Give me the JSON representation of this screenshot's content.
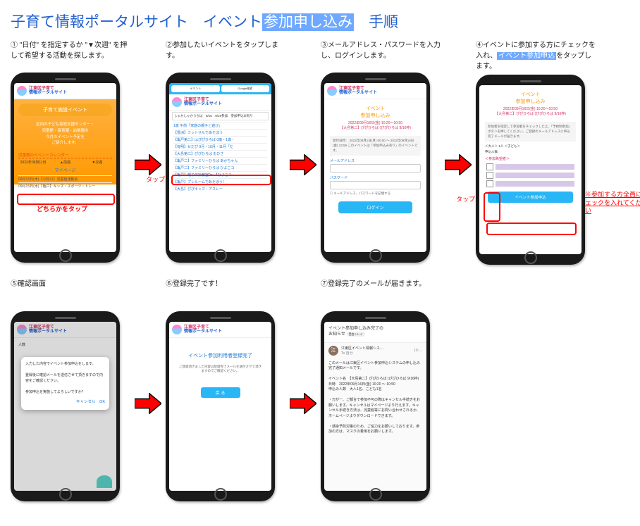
{
  "title_a": "子育て情報ポータルサイト　イベント",
  "title_hl": "参加申し込み",
  "title_b": "　手順",
  "steps": {
    "s1": "① \"日付\" を指定するか \"▼次週\" を押して希望する活動を探します。",
    "s2": "②参加したいイベントをタップします。",
    "s3": "③メールアドレス・パスワードを入力し、ログインします。",
    "s4a": "④イベントに参加する方にチェックを入れ、",
    "s4hl": "イベント参加申込",
    "s4b": "をタップします。",
    "s5": "⑤確認画面",
    "s6": "⑥登録完了です！",
    "s7": "⑦登録完了のメールが届きます。"
  },
  "portal": {
    "l1": "江東区子育て",
    "l2": "情報ポータルサイト"
  },
  "s1": {
    "ribbon": "子育て施設イベント",
    "intro1": "区内の子ども家庭支援センター・",
    "intro2": "児童館・保育園・幼稚園の",
    "intro3": "今月のイベント予定を",
    "intro4": "ご紹介します。",
    "cal": "児童館のイベントカレンダー",
    "date": "2022年09月11日",
    "prev": "▲前週",
    "next": "▼次週",
    "tap": "どちらかをタップ",
    "mypage": "マイページ",
    "e1": "09月15日(木)【小松川】児童館運動会",
    "e2": "09月15日(木)【亀戸】キッズ・スポーツ・トレー"
  },
  "s2": {
    "tab1": "イベント",
    "tab2": "Google検索",
    "head": "しゃかしゃかうちは　9/16　9/19参加　参加申込み有り",
    "i1": "1歳 午前「家庭の親子と遊び」",
    "i2": "【豊洲】フットサルであそぼう",
    "i3": "【亀戸第二】はぴぴひろば 0歳・1歳・",
    "i4": "【有明】せだぴ 9月・10月・11月「だ",
    "i5": "【大島第二】ぴぴひろば おひさ",
    "i6": "【亀戸二】ファミリーひろば あかちゃん",
    "i7": "【亀戸二】ファミリーひろば ひよこコ",
    "i8": "【亀戸】親子体操教室9～【ひよこコ",
    "i9": "【亀戸】プレルームであそぼう！",
    "i10": "【大島】ぴぴキッズ・アスレー",
    "tap": "タップ"
  },
  "s3": {
    "title": "イベント",
    "sub": "参加申し込み",
    "evt1": "2022年09月16日(金) 10:20～10:50",
    "evt2": "【大島第二】ぴぴひろば (ぴぴひろば 9/16枠)",
    "box": "受付日時： 2022年08月1日(月) 00:00 ～ 2022年09月16日(金) 23:59\nこのイベントは「参加申込み有り」のイベントです。",
    "l_mail": "メールアドレス",
    "l_pass": "パスワード",
    "remember": "メールアドレス、パスワードを記憶する",
    "login": "ログイン"
  },
  "s4": {
    "title": "イベント",
    "sub": "参加申し込み",
    "evt1": "2022年09月16日(金) 10:20～10:50",
    "evt2": "【大島第二】ぴぴひろば (ぴぴひろば 9/16枠)",
    "inst": "参加者を指定して参加者をチェックした上、「予約制参加」ボタンを押してください。ご登録のメールアドレスに申込完了メールが届きます。",
    "people": "＜大人＞ 1人 ＜子ども＞",
    "num": "申込人数:",
    "chkhead": "＜参加希望者＞",
    "apply": "イベント参加申込",
    "tap": "タップ",
    "note": "※参加する方全員にチェックを入れてください"
  },
  "s5": {
    "people": "人数",
    "d1": "入力した内容でイベント参加申込をします。",
    "d2": "登録後に確認メールを送信させて頂きますので内容をご確認ください。",
    "d3": "参加申込を実施してよろしいですか？",
    "cancel": "キャンセル",
    "ok": "OK"
  },
  "s6": {
    "done": "イベント参加利用者登録完了",
    "msg": "ご登録頂きました内容は登録完了メールを送付させて頂きますのでご確認ください。",
    "back": "戻 る"
  },
  "s7": {
    "subj1": "イベント参加申し込み完了の",
    "subj2": "お知らせ ",
    "tray": "受信トレイ",
    "from": "江東区イベント情報シス…",
    "time": "10:…",
    "to": "To 自分",
    "b1": "このメールは江東区イベント参加申込システムの申し込み完了通知メールです。",
    "b2": "イベント名　【大島第二】ぴぴひろば (ぴぴひろば 9/16枠)",
    "b3": "日時　2022年09月16日(金) 10:20 ～ 10:50",
    "b4": "申込み人数　大人1名、こども1名",
    "b5": "・万が一、ご都合で参加不可の際はキャンセル手続きをお願いします。キャンセルはマイページより行えます。キャンセル手続き方法は、児童館等にお問い合わせされるか、ホームページよりダウンロードできます。",
    "b6": "・感染予防対策のため、ご協力をお願いしております。参加の方は、マスクの着用をお願いします。"
  }
}
